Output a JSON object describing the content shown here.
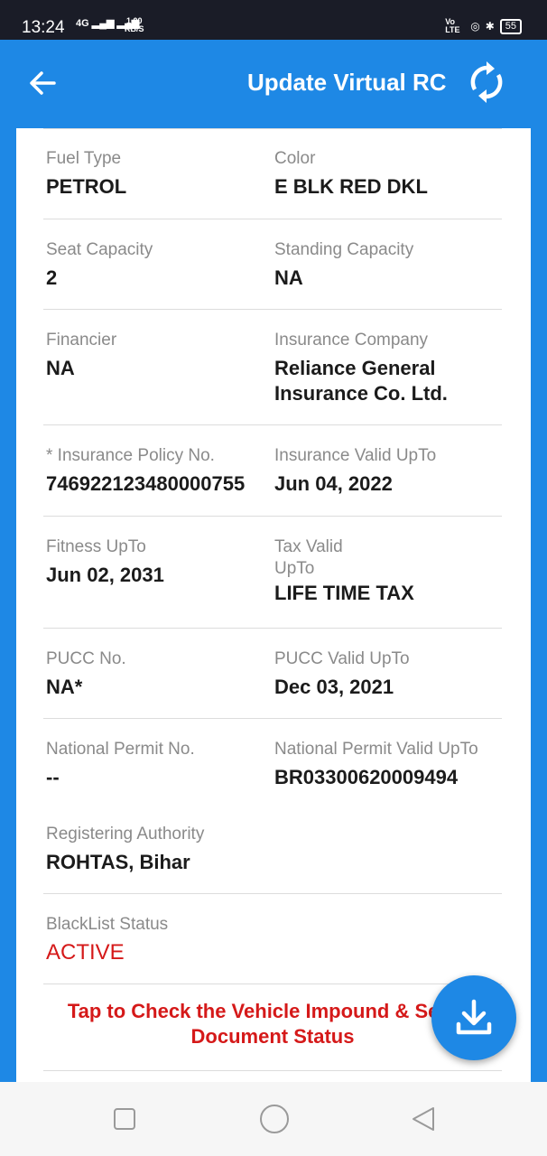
{
  "status_bar": {
    "time": "13:24",
    "network": "4G",
    "speed_value": "1.00",
    "speed_unit": "KB/S",
    "volte": "Vo LTE",
    "battery": "55"
  },
  "header": {
    "title": "Update Virtual RC",
    "back_icon": "arrow-left-icon",
    "refresh_icon": "sync-icon"
  },
  "details": {
    "fuel_type_label": "Fuel Type",
    "fuel_type": "PETROL",
    "color_label": "Color",
    "color": "E BLK RED DKL",
    "seat_capacity_label": "Seat Capacity",
    "seat_capacity": "2",
    "standing_capacity_label": "Standing Capacity",
    "standing_capacity": "NA",
    "financier_label": "Financier",
    "financier": "NA",
    "insurance_company_label": "Insurance Company",
    "insurance_company": "Reliance General Insurance Co. Ltd.",
    "policy_no_label": "* Insurance Policy No.",
    "policy_no": "746922123480000755",
    "insurance_valid_label": "Insurance Valid UpTo",
    "insurance_valid": "Jun 04, 2022",
    "fitness_label": "Fitness UpTo",
    "fitness": "Jun 02, 2031",
    "tax_valid_label": "Tax Valid UpTo",
    "tax_valid": "LIFE TIME TAX",
    "pucc_no_label": "PUCC No.",
    "pucc_no": "NA*",
    "pucc_valid_label": "PUCC Valid UpTo",
    "pucc_valid": "Dec 03, 2021",
    "national_permit_label": "National Permit No.",
    "national_permit": "--",
    "national_permit_valid_label": "National Permit Valid UpTo",
    "national_permit_valid": "BR03300620009494",
    "registering_authority_label": "Registering Authority",
    "registering_authority": "ROHTAS, Bihar",
    "blacklist_label": "BlackList Status",
    "blacklist": "ACTIVE"
  },
  "impound_link": "Tap to Check the Vehicle Impound & Seized Document Status",
  "fab_icon": "download-icon",
  "colors": {
    "primary": "#1e88e5",
    "danger": "#d51919"
  }
}
